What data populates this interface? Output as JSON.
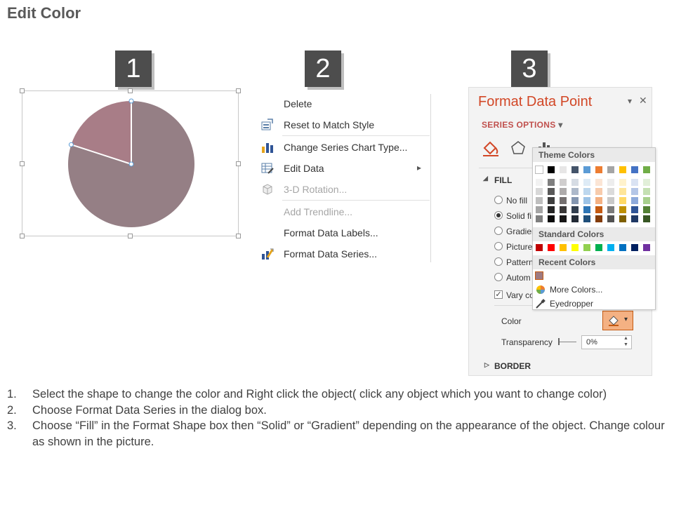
{
  "page": {
    "title": "Edit Color"
  },
  "steps": {
    "one": "1",
    "two": "2",
    "three": "3"
  },
  "context_menu": {
    "items": [
      {
        "label": "Delete",
        "icon": "none",
        "disabled": false
      },
      {
        "label": "Reset to Match Style",
        "icon": "reset-style-icon",
        "disabled": false
      },
      {
        "label": "Change Series Chart Type...",
        "icon": "bar-chart-icon",
        "disabled": false
      },
      {
        "label": "Edit Data",
        "icon": "table-edit-icon",
        "disabled": false,
        "submenu": "▸"
      },
      {
        "label": "3-D Rotation...",
        "icon": "cube-icon",
        "disabled": true
      },
      {
        "label": "Add Trendline...",
        "icon": "none",
        "disabled": true
      },
      {
        "label": "Format Data Labels...",
        "icon": "none",
        "disabled": false
      },
      {
        "label": "Format Data Series...",
        "icon": "format-series-icon",
        "disabled": false
      }
    ]
  },
  "format_panel": {
    "title": "Format Data Point",
    "dropdown": "▾",
    "close": "✕",
    "series_options": "SERIES OPTIONS",
    "series_options_caret": "▾",
    "fill_header": "FILL",
    "fill_caret": "◢",
    "fill_options": [
      "No fill",
      "Solid fi",
      "Gradien",
      "Picture",
      "Pattern",
      "Autom"
    ],
    "vary_label": "Vary co",
    "vary_check": "✓",
    "color_label": "Color",
    "transparency_label": "Transparency",
    "transparency_value": "0%",
    "border_header": "BORDER",
    "border_caret": "▷"
  },
  "palette": {
    "theme_header": "Theme Colors",
    "standard_header": "Standard Colors",
    "recent_header": "Recent Colors",
    "more_colors": "More Colors...",
    "eyedropper": "Eyedropper",
    "theme_top": [
      "#ffffff",
      "#000000",
      "#e7e6e6",
      "#44546a",
      "#5b9bd5",
      "#ed7d31",
      "#a5a5a5",
      "#ffc000",
      "#4472c4",
      "#70ad47"
    ],
    "theme_shades": [
      [
        "#f2f2f2",
        "#7f7f7f",
        "#d0cece",
        "#d6dce4",
        "#deebf6",
        "#fbe5d5",
        "#ededed",
        "#fff2cc",
        "#dae3f3",
        "#e2efd9"
      ],
      [
        "#d8d8d8",
        "#595959",
        "#aeabab",
        "#adb9ca",
        "#bdd7ee",
        "#f7cbac",
        "#dbdbdb",
        "#fee599",
        "#b4c6e7",
        "#c5e0b3"
      ],
      [
        "#bfbfbf",
        "#3f3f3f",
        "#757070",
        "#8496b0",
        "#9dc3e6",
        "#f4b183",
        "#c9c9c9",
        "#ffd965",
        "#8eaadb",
        "#a8d08d"
      ],
      [
        "#a5a5a5",
        "#262626",
        "#3a3838",
        "#323f4f",
        "#2e75b5",
        "#c55a11",
        "#7b7b7b",
        "#bf9000",
        "#2f5496",
        "#538135"
      ],
      [
        "#7f7f7f",
        "#0c0c0c",
        "#171616",
        "#222a35",
        "#1f4e79",
        "#833c0b",
        "#525252",
        "#7f6000",
        "#1f3864",
        "#375623"
      ]
    ],
    "standard": [
      "#c00000",
      "#ff0000",
      "#ffc000",
      "#ffff00",
      "#92d050",
      "#00b050",
      "#00b0f0",
      "#0070c0",
      "#002060",
      "#7030a0"
    ],
    "recent": [
      "#9e7a80"
    ]
  },
  "chart_data": {
    "type": "pie",
    "title": "",
    "values": [
      80,
      20
    ],
    "colors": [
      "#957f85",
      "#a87d87"
    ],
    "selected_slice": 1
  },
  "instructions": [
    {
      "num": "1.",
      "text": "Select the shape to change the color and Right click the object( click any object which you want to change color)"
    },
    {
      "num": "2.",
      "text": "Choose Format Data Series in the dialog box."
    },
    {
      "num": "3.",
      "text": "Choose “Fill” in the Format Shape box then “Solid” or “Gradient” depending on the appearance of the object. Change colour as shown in the picture."
    }
  ]
}
